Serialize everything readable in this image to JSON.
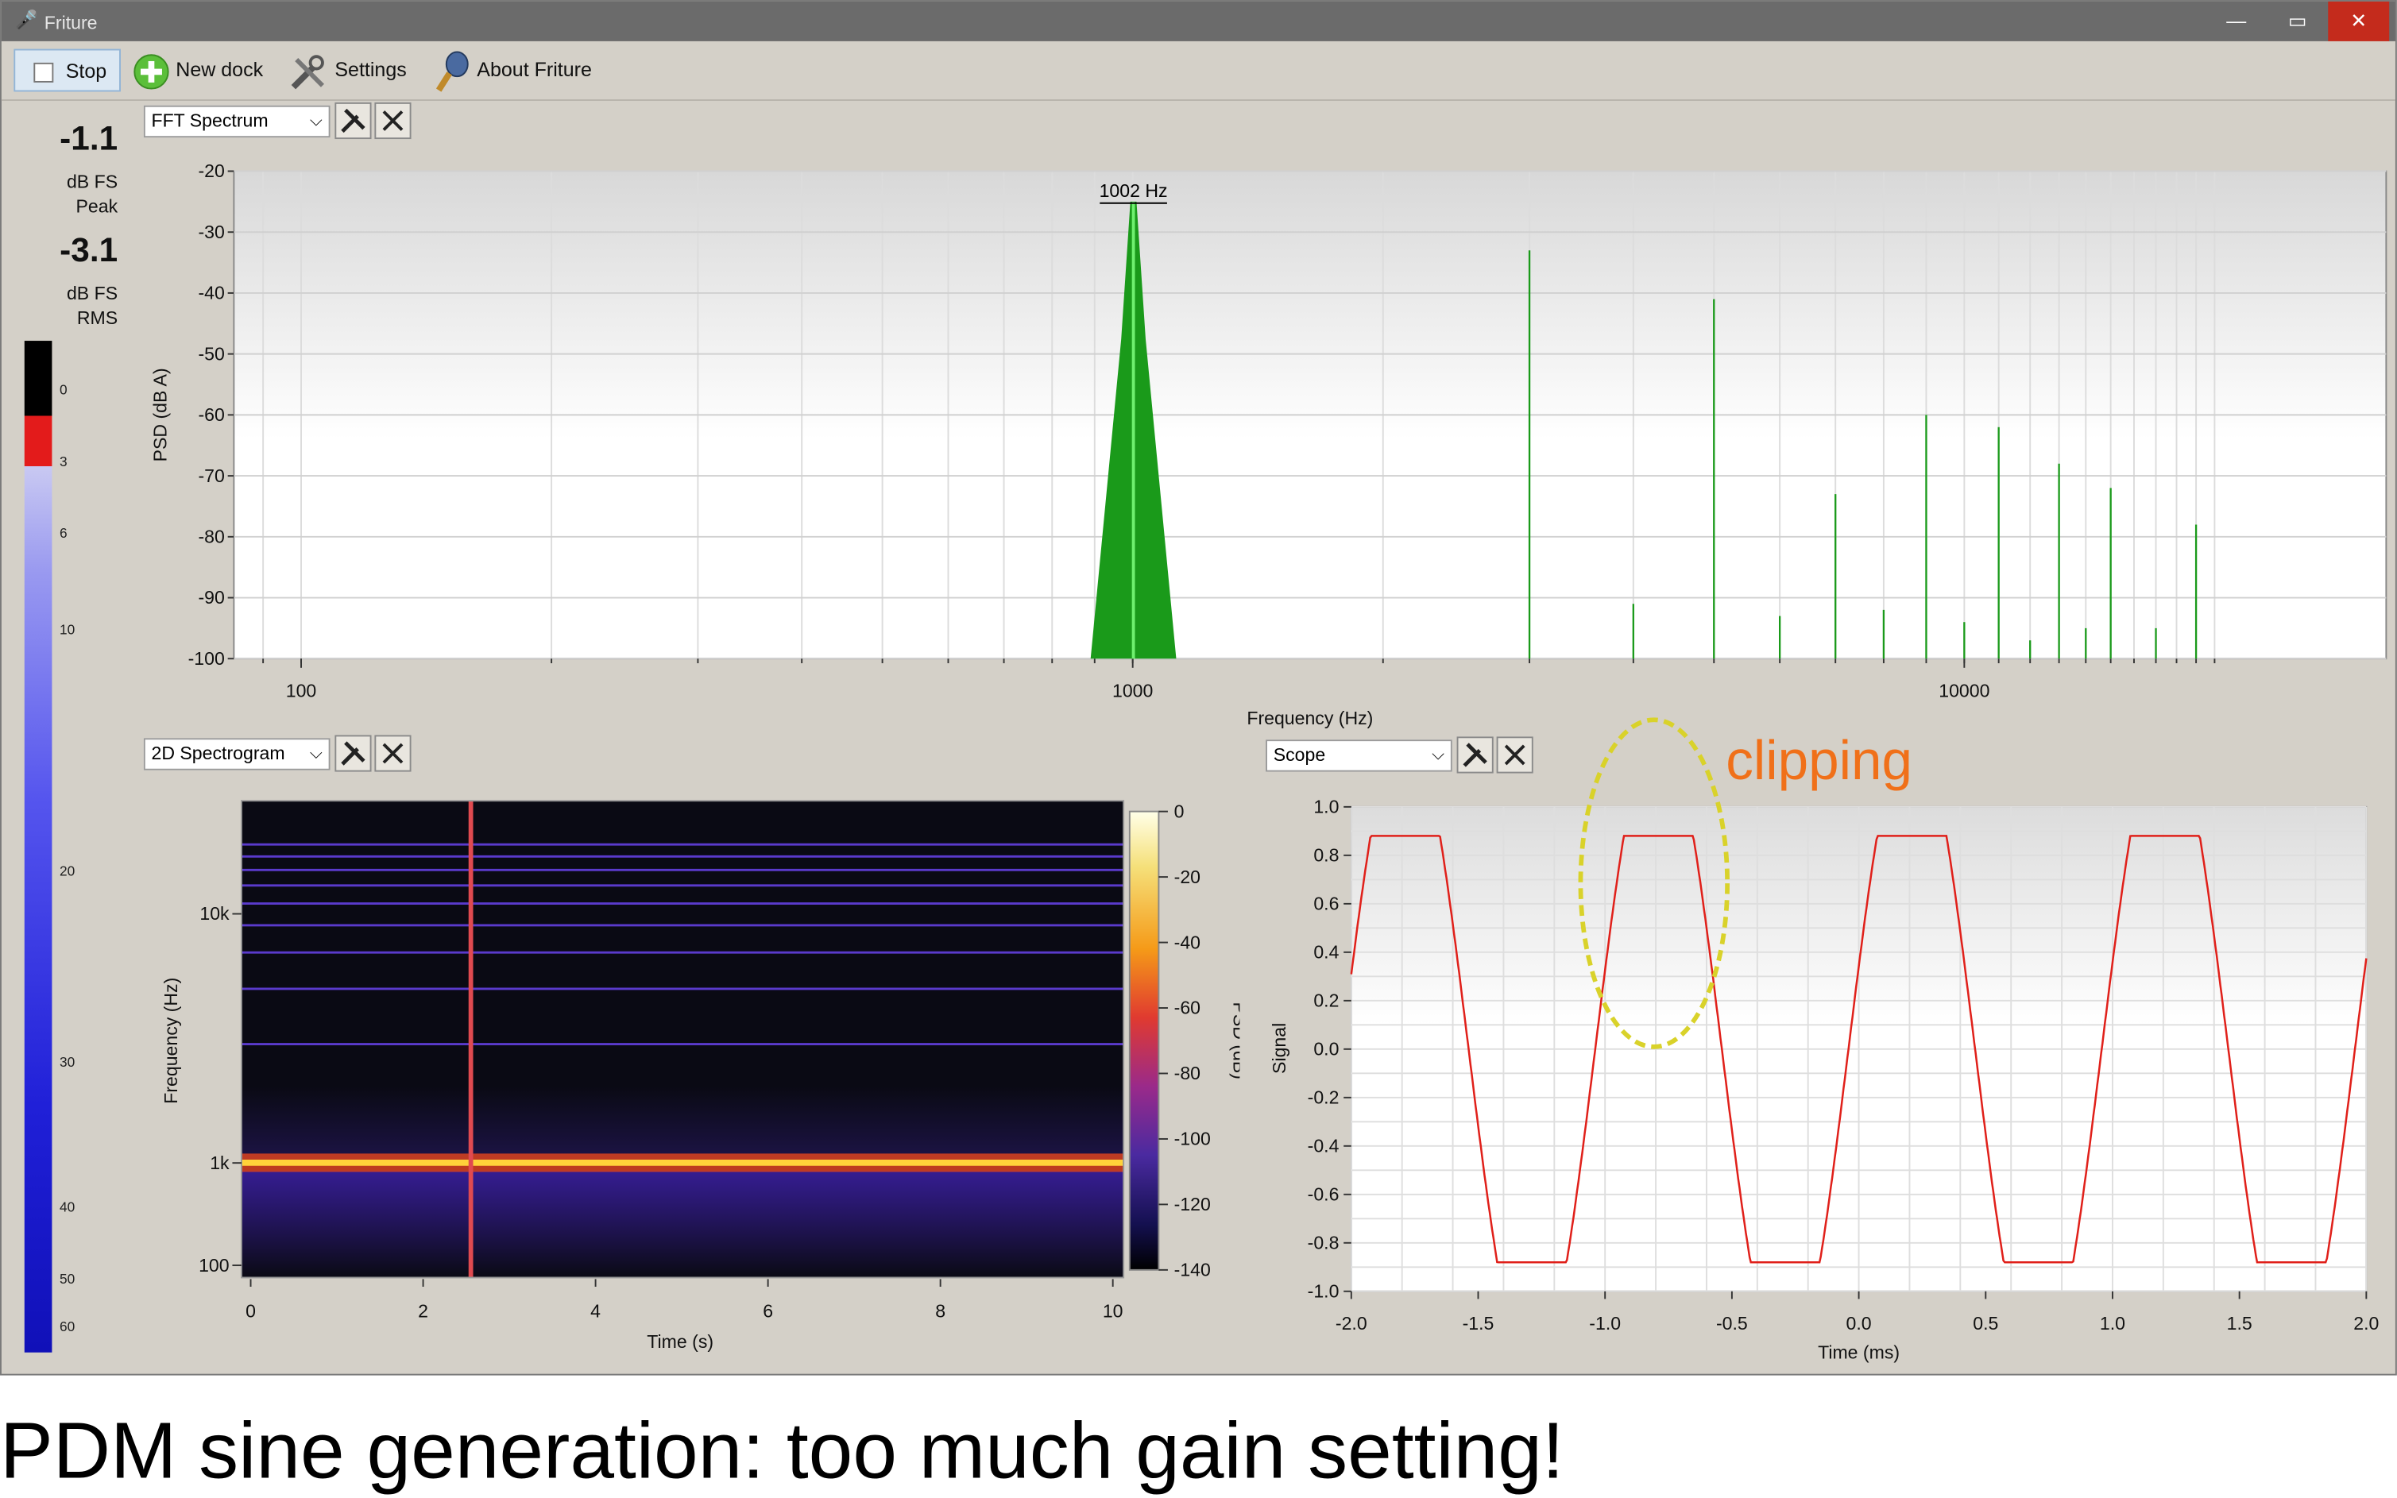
{
  "window": {
    "title": "Friture"
  },
  "toolbar": {
    "stop_label": "Stop",
    "new_dock_label": "New dock",
    "settings_label": "Settings",
    "about_label": "About Friture"
  },
  "levels": {
    "peak_value": "-1.1",
    "peak_unit": "dB FS",
    "peak_label": "Peak",
    "rms_value": "-3.1",
    "rms_unit": "dB FS",
    "rms_label": "RMS",
    "scale_ticks": [
      "0",
      "3",
      "6",
      "10",
      "20",
      "30",
      "40",
      "50",
      "60"
    ]
  },
  "docks": {
    "fft_select": "FFT Spectrum",
    "spectrogram_select": "2D Spectrogram",
    "scope_select": "Scope"
  },
  "annotation": {
    "clipping": "clipping"
  },
  "caption": "PDM sine generation: too much gain setting!",
  "colors": {
    "spectrum": "#1a9a1a",
    "scope": "#e0201a",
    "annotation_text": "#f07019",
    "annotation_circle": "#d9d22a"
  },
  "chart_data": [
    {
      "type": "bar",
      "name": "fft",
      "title": "",
      "xlabel": "Frequency (Hz)",
      "ylabel": "PSD (dB A)",
      "xscale": "log",
      "xlim": [
        20,
        24000
      ],
      "ylim": [
        -100,
        -20
      ],
      "xticks": [
        "100",
        "1000",
        "10000"
      ],
      "yticks": [
        "-20",
        "-30",
        "-40",
        "-50",
        "-60",
        "-70",
        "-80",
        "-90",
        "-100"
      ],
      "peak_label": "1002 Hz",
      "peaks": [
        {
          "f": 1002,
          "db": -25
        },
        {
          "f": 3000,
          "db": -33
        },
        {
          "f": 4000,
          "db": -91
        },
        {
          "f": 5000,
          "db": -41
        },
        {
          "f": 6000,
          "db": -93
        },
        {
          "f": 7000,
          "db": -73
        },
        {
          "f": 8000,
          "db": -92
        },
        {
          "f": 9000,
          "db": -60
        },
        {
          "f": 10000,
          "db": -94
        },
        {
          "f": 11000,
          "db": -62
        },
        {
          "f": 12000,
          "db": -97
        },
        {
          "f": 13000,
          "db": -68
        },
        {
          "f": 14000,
          "db": -95
        },
        {
          "f": 15000,
          "db": -72
        },
        {
          "f": 17000,
          "db": -95
        },
        {
          "f": 19000,
          "db": -78
        }
      ]
    },
    {
      "type": "heatmap",
      "name": "spectrogram",
      "xlabel": "Time (s)",
      "ylabel": "Frequency (Hz)",
      "colorbar_label": "PSD (dB)",
      "xlim": [
        0,
        10
      ],
      "xticks": [
        "0",
        "2",
        "4",
        "6",
        "8",
        "10"
      ],
      "yticks": [
        "10k",
        "1k",
        "100"
      ],
      "cticks": [
        "0",
        "-20",
        "-40",
        "-60",
        "-80",
        "-100",
        "-120",
        "-140"
      ],
      "dominant_freq": 1002,
      "transient_time": 2.6,
      "harmonic_lines_hz": [
        3000,
        5000,
        7000,
        9000,
        11000,
        13000,
        15000,
        17000,
        19000
      ]
    },
    {
      "type": "line",
      "name": "scope",
      "xlabel": "Time (ms)",
      "ylabel": "Signal",
      "xlim": [
        -2.0,
        2.0
      ],
      "ylim": [
        -1.0,
        1.0
      ],
      "xticks": [
        "-2.0",
        "-1.5",
        "-1.0",
        "-0.5",
        "0.0",
        "0.5",
        "1.0",
        "1.5",
        "2.0"
      ],
      "yticks": [
        "1.0",
        "0.8",
        "0.6",
        "0.4",
        "0.2",
        "0.0",
        "-0.2",
        "-0.4",
        "-0.6",
        "-0.8",
        "-1.0"
      ],
      "frequency_khz": 1.002,
      "clip_level": 0.88
    }
  ]
}
